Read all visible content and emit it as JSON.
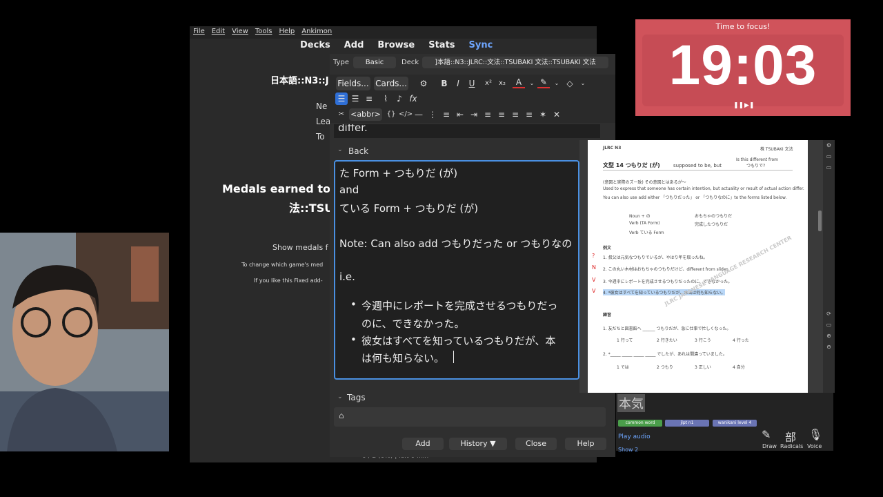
{
  "menubar": {
    "items": [
      "File",
      "Edit",
      "View",
      "Tools",
      "Help",
      "Ankimon"
    ]
  },
  "nav": {
    "decks": "Decks",
    "add": "Add",
    "browse": "Browse",
    "stats": "Stats",
    "sync": "Sync"
  },
  "background": {
    "deck_title": "日本語::N3::J",
    "stat_ne": "Ne",
    "stat_lea": "Lea",
    "stat_to": "To",
    "medals_line1": "Medals earned to",
    "medals_line2": "法::TSU",
    "show_medals": "Show medals f",
    "change_text": "To change which game's med",
    "like_text": "If you like this Fixed add-",
    "bottom_status": "0 / 2 (0%) | left 0 min"
  },
  "add_dialog": {
    "type_label": "Type",
    "type_value": "Basic",
    "deck_label": "Deck",
    "deck_value": "]本語::N3::JLRC::文法::TSUBAKI 文法::TSUBAKI 文法",
    "fields_button": "Fields...",
    "cards_button": "Cards...",
    "abbr_button": "<abbr>",
    "prev_field_text": "differ.",
    "back_label": "Back",
    "back_lines": [
      "た Form + つもりだ (が)",
      "and",
      "ている Form + つもりだ (が)",
      "",
      "Note: Can also add つもりだった or つもりなの",
      "",
      "i.e."
    ],
    "bullets": [
      "今週中にレポートを完成させるつもりだっ",
      "のに、できなかった。",
      "彼女はすべてを知っているつもりだが、本",
      "は何も知らない。"
    ],
    "tags_label": "Tags",
    "buttons": {
      "add": "Add",
      "history": "History ▼",
      "close": "Close",
      "help": "Help"
    }
  },
  "timer": {
    "title": "Time to focus!",
    "time": "19:03",
    "pause": "❚❚",
    "skip": "▶❚"
  },
  "pdf": {
    "header_left": "JLRC N3",
    "header_right": "株 TSUBAKI 文法",
    "title": "文型 14  つもりだ (が)",
    "title_en": "supposed to be, but",
    "note": "Is this different from",
    "note2": "つもりで?",
    "jp_heading": "(意図と実際のズー致) その意図とはあるが～",
    "desc1": "Used to express that someone has certain intention, but actuality or result of actual action differ.",
    "desc2": "You can also use add either 「つもりだった」 or 「つもりなのに」to the forms listed below.",
    "forms": [
      [
        "Noun + の",
        "おもちゃのつもりだ"
      ],
      [
        "Verb (TA Form)",
        "完成したつもりだ"
      ],
      [
        "Verb ている Form",
        ""
      ]
    ],
    "examples_heading": "例文",
    "examples": [
      "1. 叔父は元気なつもりでいるが、やはり年を取ったね。",
      "2. この丸い木材はおもちゃのつもりだけど、different from slides",
      "3. 今週中にレポートを完成させるつもりだったのに、できなかった。",
      "4. *彼女はすべてを知っているつもりだが、本当は何も知らない。"
    ],
    "marks": [
      "?",
      "N",
      "V",
      "V"
    ],
    "practice_heading": "練習",
    "practice1": "1. 友だちと図書館へ ______ つもりだが、急に仕事で忙しくなった。",
    "practice1_opts": [
      "1 行って",
      "2 行きたい",
      "3 行こう",
      "4 行った"
    ],
    "practice2": "2. *_____ _____ _____ _____ でしたが、あれは間違っていました。",
    "practice2_opts": [
      "1 では",
      "2 つもり",
      "3 正しい",
      "4 自分"
    ],
    "watermark": "JLRC JAPANESE LANGUAGE RESEARCH CENTER"
  },
  "lower_right": {
    "kanji": "本気",
    "tags": [
      "common word",
      "jlpt n1",
      "wanikani level 4"
    ],
    "play_audio": "Play audio",
    "show2": "Show 2",
    "draw": "Draw",
    "radicals": "Radicals",
    "voice": "Voice",
    "radicals_glyph": "部"
  },
  "colors": {
    "timer_bg": "#d0535b",
    "link": "#6ea6ff",
    "focus_border": "#4a90e2"
  }
}
